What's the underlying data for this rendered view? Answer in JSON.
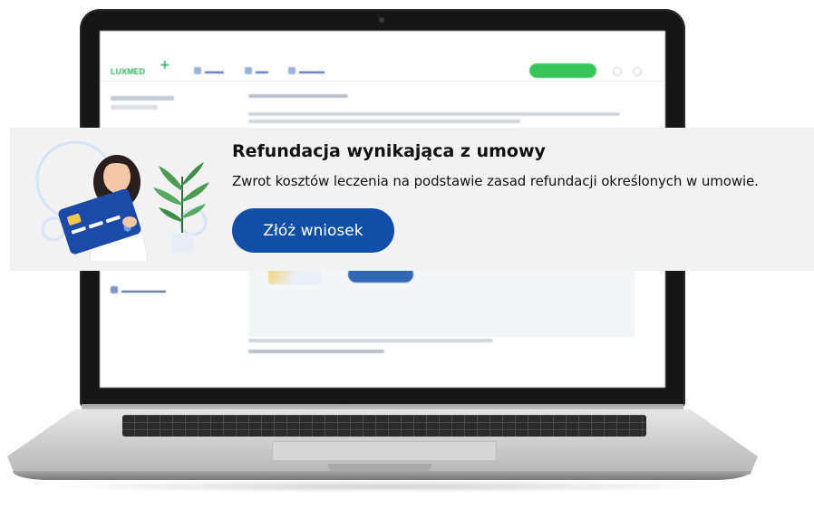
{
  "banner": {
    "title": "Refundacja wynikająca z umowy",
    "description": "Zwrot kosztów leczenia na podstawie zasad refundacji określonych w umowie.",
    "button_label": "Złóż wniosek",
    "illustration": "woman-holding-credit-card-with-plant-illustration"
  },
  "colors": {
    "primary_blue": "#0f4fa6",
    "brand_green": "#39c45a",
    "banner_bg": "#f2f2f2",
    "text": "#111111"
  },
  "icons": [
    "credit-card-icon",
    "plant-icon",
    "user-icon",
    "bell-icon"
  ]
}
